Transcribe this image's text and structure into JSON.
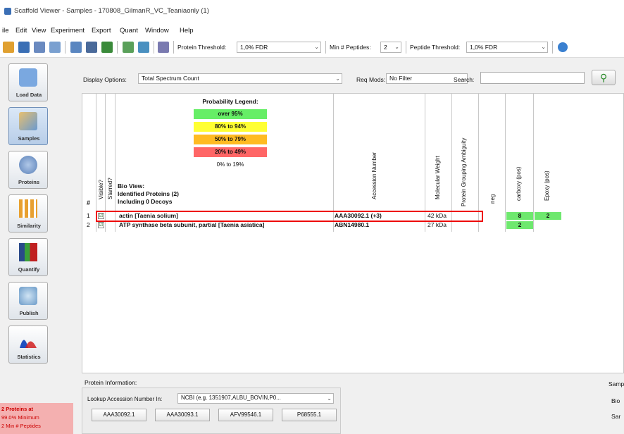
{
  "window": {
    "title": "Scaffold Viewer - Samples - 170808_GilmanR_VC_Teaniaonly (1)"
  },
  "menu": [
    "ile",
    "Edit",
    "View",
    "Experiment",
    "Export",
    "Quant",
    "Window",
    "Help"
  ],
  "toolbar": {
    "protein_threshold_label": "Protein Threshold:",
    "protein_threshold_value": "1,0% FDR",
    "min_peptides_label": "Min # Peptides:",
    "min_peptides_value": "2",
    "peptide_threshold_label": "Peptide Threshold:",
    "peptide_threshold_value": "1,0% FDR"
  },
  "nav": [
    {
      "label": "Load Data",
      "icon": "load-data-icon"
    },
    {
      "label": "Samples",
      "icon": "samples-icon",
      "selected": true
    },
    {
      "label": "Proteins",
      "icon": "proteins-icon"
    },
    {
      "label": "Similarity",
      "icon": "similarity-icon"
    },
    {
      "label": "Quantify",
      "icon": "quantify-icon"
    },
    {
      "label": "Publish",
      "icon": "publish-icon"
    },
    {
      "label": "Statistics",
      "icon": "statistics-icon"
    }
  ],
  "status": {
    "line1": "2 Proteins at",
    "line2": "99.0% Minimum",
    "line3": "2 Min # Peptides"
  },
  "display_options": {
    "label": "Display Options:",
    "value": "Total Spectrum Count",
    "req_mods_label": "Req Mods:",
    "req_mods_value": "No Filter",
    "search_label": "Search:"
  },
  "legend": {
    "title": "Probability Legend:",
    "items": [
      {
        "label": "over 95%",
        "color": "#66ee66"
      },
      {
        "label": "80% to 94%",
        "color": "#ffff33"
      },
      {
        "label": "50% to 79%",
        "color": "#ffbb22"
      },
      {
        "label": "20% to 49%",
        "color": "#ff6666"
      },
      {
        "label": "0% to 19%",
        "color": "#ffffff"
      }
    ]
  },
  "bio_view": {
    "title": "Bio View:",
    "identified": "Identified Proteins (2)",
    "decoys": "Including 0 Decoys"
  },
  "columns": {
    "num": "#",
    "visible": "Visible?",
    "starred": "Starred?",
    "accession": "Accession Number",
    "mw": "Molecular Weight",
    "grouping": "Protein Grouping Ambiguity",
    "neg": "neg",
    "carboxy": "carboxy (pos)",
    "epoxy": "Epoxy (pos)"
  },
  "rows": [
    {
      "num": "1",
      "check": "☑",
      "name": "actin [Taenia solium]",
      "accession": "AAA30092.1 (+3)",
      "mw": "42 kDa",
      "carboxy": "8",
      "epoxy": "2"
    },
    {
      "num": "2",
      "check": "☑",
      "name": "ATP synthase beta subunit, partial [Taenia asiatica]",
      "accession": "ABN14980.1",
      "mw": "27 kDa",
      "carboxy": "2",
      "epoxy": ""
    }
  ],
  "protein_info": {
    "label": "Protein Information:",
    "lookup_label": "Lookup Accession Number In:",
    "lookup_value": "NCBI (e.g. 1351907,ALBU_BOVIN,P0...",
    "accessions": [
      "AAA30092.1",
      "AAA30093.1",
      "AFV99546.1",
      "P68555.1"
    ],
    "right_label": "Samp",
    "right_1": "Bio",
    "right_2": "Sar"
  }
}
